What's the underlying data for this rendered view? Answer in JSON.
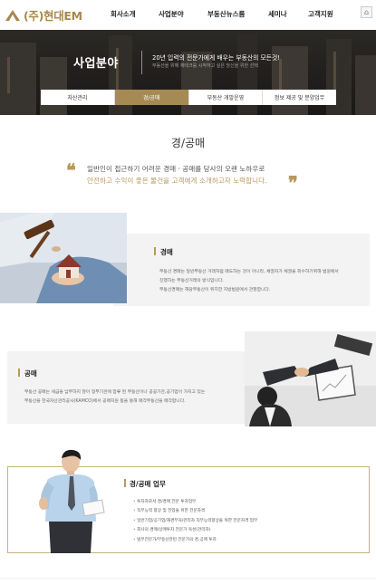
{
  "header": {
    "logo_text": "(주)현대EM",
    "nav": [
      "회사소개",
      "사업분야",
      "부동산뉴스룸",
      "세미나",
      "고객지원"
    ]
  },
  "hero": {
    "title": "사업분야",
    "subtitle": "20년 입력의 전문가에게 배우는 부동산의 모든것!",
    "subtitle_small": "부동산을 위해 재테크를 시작하고 싶은 당신을 위한 선택"
  },
  "tabs": [
    {
      "label": "자산관리",
      "active": false
    },
    {
      "label": "경/공매",
      "active": true
    },
    {
      "label": "부동산 개발운영",
      "active": false
    },
    {
      "label": "정보 제공 및 분양업무",
      "active": false
    }
  ],
  "page_title": "경/공매",
  "intro": {
    "line1": "일반인이 접근하기 어려운 경매 · 공매를 당사의 오랜 노하우로",
    "line2": "안전하고 수익이 좋은 물건을 고객에게 소개하고자 노력합니다."
  },
  "section_auction": {
    "heading": "경매",
    "lines": [
      "부동산 경매는 일반부동산 거래처럼 매도하는 것이 아니라, 채권자가 채권을 회수하기위해 법원에서",
      "진행하는 부동산거래의 방식입니다.",
      "부동산경매는 해당부동산이 위치한 지방법원에서 관할합니다."
    ]
  },
  "section_public": {
    "heading": "공매",
    "lines": [
      "부동산 공매는 세금을 납부하지 않아 정부기관에 압류 된 부동산이나 공공기관,공기업이 가지고 있는",
      "부동산을 한국자산관리공사(KAMCO)에서 공매지원 등을 통해 매각부동산을 매각합니다."
    ]
  },
  "section_work": {
    "heading": "경/공매 업무",
    "items": [
      "투자자로서 경/경매 전문 투자업무",
      "직무능력 향상 및 전업을 위한 전문자격",
      "일반기업/공기업/재경부처/관리자 직무능력향상을 위한 전문자격 업무",
      "회사의 경매/상매투자 전문가 육성(관리자)",
      "법무전문가/부동산관련 전문가의 경,공매 투자"
    ]
  },
  "colors": {
    "accent": "#a68a53",
    "gold_text": "#b8995a"
  }
}
